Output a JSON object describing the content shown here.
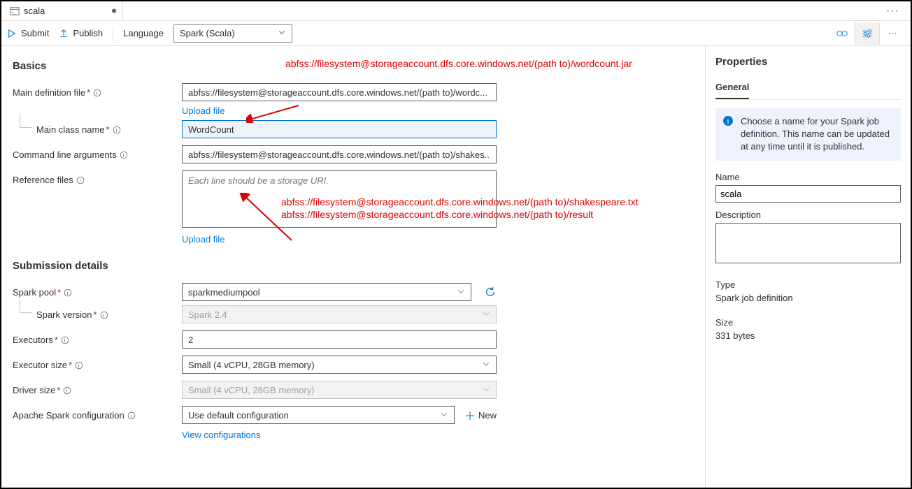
{
  "tab": {
    "title": "scala"
  },
  "toolbar": {
    "submit": "Submit",
    "publish": "Publish",
    "language_label": "Language",
    "language_value": "Spark (Scala)"
  },
  "basics": {
    "heading": "Basics",
    "main_def_label": "Main definition file",
    "main_def_value": "abfss://filesystem@storageaccount.dfs.core.windows.net/(path to)/wordc...",
    "upload_file": "Upload file",
    "main_class_label": "Main class name",
    "main_class_value": "WordCount",
    "cmd_args_label": "Command line arguments",
    "cmd_args_value": "abfss://filesystem@storageaccount.dfs.core.windows.net/(path to)/shakes...",
    "ref_files_label": "Reference files",
    "ref_files_placeholder": "Each line should be a storage URI."
  },
  "submission": {
    "heading": "Submission details",
    "spark_pool_label": "Spark pool",
    "spark_pool_value": "sparkmediumpool",
    "spark_version_label": "Spark version",
    "spark_version_value": "Spark 2.4",
    "executors_label": "Executors",
    "executors_value": "2",
    "executor_size_label": "Executor size",
    "executor_size_value": "Small (4 vCPU, 28GB memory)",
    "driver_size_label": "Driver size",
    "driver_size_value": "Small (4 vCPU, 28GB memory)",
    "spark_conf_label": "Apache Spark configuration",
    "spark_conf_value": "Use default configuration",
    "new_label": "New",
    "view_conf": "View configurations"
  },
  "annotations": {
    "a1": "abfss://filesystem@storageaccount.dfs.core.windows.net/(path to)/wordcount.jar",
    "a2": "abfss://filesystem@storageaccount.dfs.core.windows.net/(path to)/shakespeare.txt",
    "a3": "abfss://filesystem@storageaccount.dfs.core.windows.net/(path to)/result"
  },
  "properties": {
    "heading": "Properties",
    "tab": "General",
    "info": "Choose a name for your Spark job definition. This name can be updated at any time until it is published.",
    "name_label": "Name",
    "name_value": "scala",
    "description_label": "Description",
    "type_label": "Type",
    "type_value": "Spark job definition",
    "size_label": "Size",
    "size_value": "331 bytes"
  }
}
